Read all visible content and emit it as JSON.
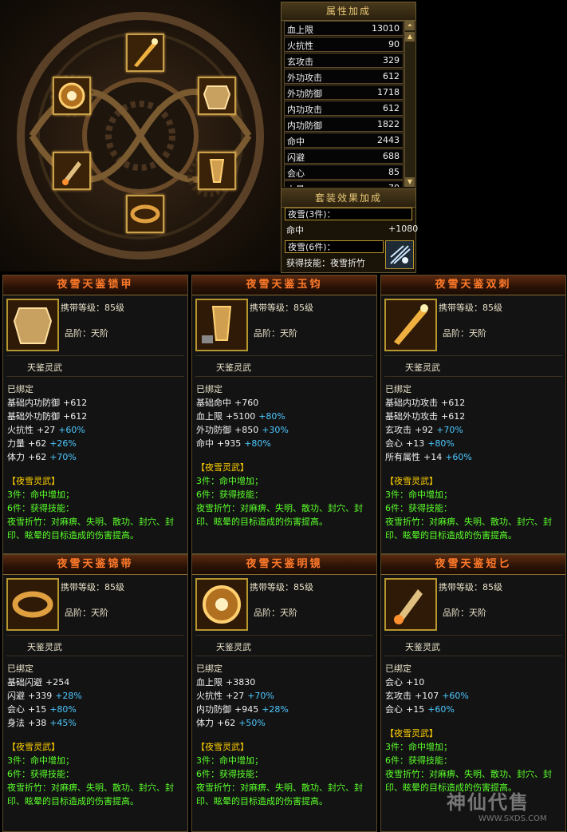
{
  "attr_panel": {
    "title": "属性加成",
    "rows": [
      {
        "k": "血上限",
        "v": "13010"
      },
      {
        "k": "火抗性",
        "v": "90"
      },
      {
        "k": "玄攻击",
        "v": "329"
      },
      {
        "k": "外功攻击",
        "v": "612"
      },
      {
        "k": "外功防御",
        "v": "1718"
      },
      {
        "k": "内功攻击",
        "v": "612"
      },
      {
        "k": "内功防御",
        "v": "1822"
      },
      {
        "k": "命中",
        "v": "2443"
      },
      {
        "k": "闪避",
        "v": "688"
      },
      {
        "k": "会心",
        "v": "85"
      },
      {
        "k": "力量",
        "v": "70"
      }
    ]
  },
  "set_panel": {
    "title": "套装效果加成",
    "set3_label": "夜雪(3件)：",
    "set3_stat": "命中",
    "set3_value": "+1080",
    "set6_label": "夜雪(6件)：",
    "set6_text": "获得技能：夜雪折竹"
  },
  "common": {
    "level_label": "携带等级：85级",
    "grade_label": "品阶：天阶",
    "wu_tag": "天鉴灵武",
    "bound": "已绑定",
    "set_name": "【夜雪灵武】",
    "set3": "3件：命中增加；",
    "set6": "6件：获得技能：",
    "skill_desc": "夜雪折竹：对麻痹、失明、散功、封穴、封印、眩晕的目标造成的伤害提高。"
  },
  "cards": [
    {
      "name": "夜雪天鉴锁甲",
      "lines": [
        {
          "k": "基础内功防御",
          "v": "+612",
          "p": ""
        },
        {
          "k": "基础外功防御",
          "v": "+612",
          "p": ""
        },
        {
          "k": "火抗性",
          "v": "+27",
          "p": "+60%"
        },
        {
          "k": "力量",
          "v": "+62",
          "p": "+26%"
        },
        {
          "k": "体力",
          "v": "+62",
          "p": "+70%"
        }
      ]
    },
    {
      "name": "夜雪天鉴玉钧",
      "lines": [
        {
          "k": "基础命中",
          "v": "+760",
          "p": ""
        },
        {
          "k": "血上限",
          "v": "+5100",
          "p": "+80%"
        },
        {
          "k": "外功防御",
          "v": "+850",
          "p": "+30%"
        },
        {
          "k": "命中",
          "v": "+935",
          "p": "+80%"
        }
      ]
    },
    {
      "name": "夜雪天鉴双刺",
      "lines": [
        {
          "k": "基础内功攻击",
          "v": "+612",
          "p": ""
        },
        {
          "k": "基础外功攻击",
          "v": "+612",
          "p": ""
        },
        {
          "k": "玄攻击",
          "v": "+92",
          "p": "+70%"
        },
        {
          "k": "会心",
          "v": "+13",
          "p": "+80%"
        },
        {
          "k": "所有属性",
          "v": "+14",
          "p": "+60%"
        }
      ]
    },
    {
      "name": "夜雪天鉴锦带",
      "lines": [
        {
          "k": "基础闪避",
          "v": "+254",
          "p": ""
        },
        {
          "k": "闪避",
          "v": "+339",
          "p": "+28%"
        },
        {
          "k": "会心",
          "v": "+15",
          "p": "+80%"
        },
        {
          "k": "身法",
          "v": "+38",
          "p": "+45%"
        }
      ]
    },
    {
      "name": "夜雪天鉴明镜",
      "lines": [
        {
          "k": "血上限",
          "v": "+3830",
          "p": ""
        },
        {
          "k": "火抗性",
          "v": "+27",
          "p": "+70%"
        },
        {
          "k": "内功防御",
          "v": "+945",
          "p": "+28%"
        },
        {
          "k": "体力",
          "v": "+62",
          "p": "+50%"
        }
      ]
    },
    {
      "name": "夜雪天鉴短匕",
      "lines": [
        {
          "k": "会心",
          "v": "+10",
          "p": ""
        },
        {
          "k": "玄攻击",
          "v": "+107",
          "p": "+60%"
        },
        {
          "k": "会心",
          "v": "+15",
          "p": "+60%"
        }
      ]
    }
  ],
  "watermark": {
    "main": "神仙代售",
    "url": "WWW.SXDS.COM"
  }
}
